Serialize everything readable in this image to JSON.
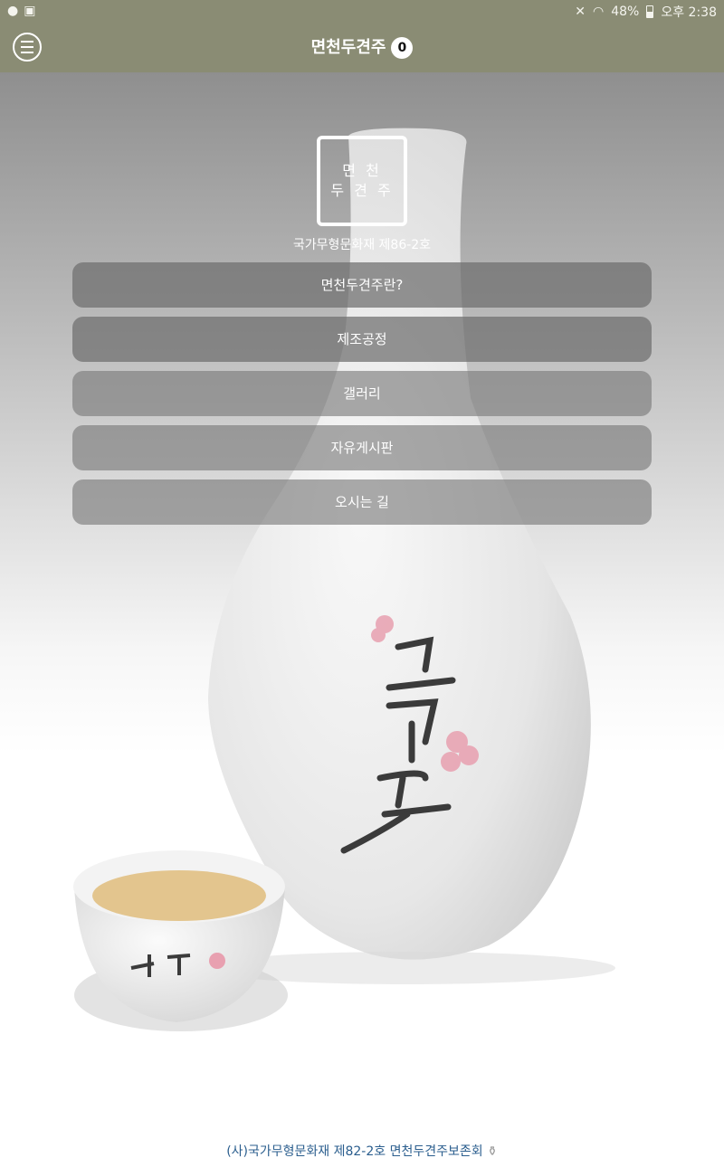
{
  "status_bar": {
    "battery": "48%",
    "time": "오후 2:38"
  },
  "app_bar": {
    "title": "면천두견주",
    "badge_count": "0"
  },
  "logo": {
    "line1": "면 천",
    "line2": "두 견 주"
  },
  "subtitle": "국가무형문화재 제86-2호",
  "menu": {
    "items": [
      {
        "label": "면천두견주란?"
      },
      {
        "label": "제조공정"
      },
      {
        "label": "갤러리"
      },
      {
        "label": "자유게시판"
      },
      {
        "label": "오시는 길"
      }
    ]
  },
  "footer": {
    "text": "(사)국가무형문화재 제82-2호 면천두견주보존회"
  },
  "colors": {
    "app_bar": "#8a8c74",
    "menu_item": "#6e6e6e",
    "footer_link": "#2b5e8e"
  }
}
